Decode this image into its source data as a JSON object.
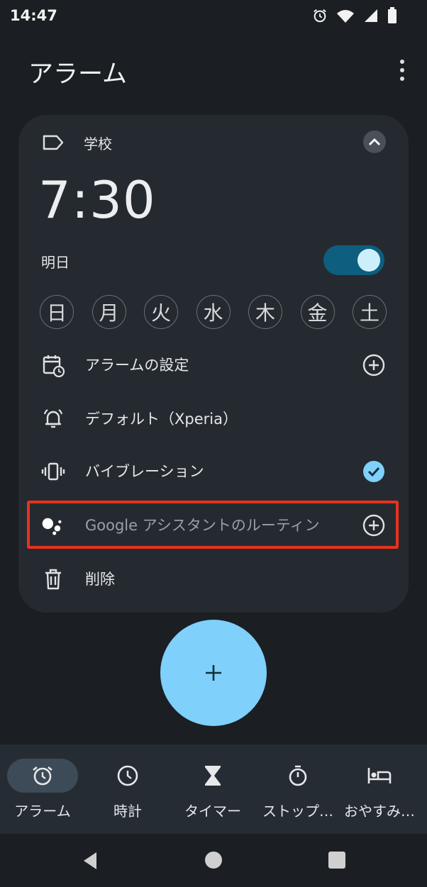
{
  "status_bar": {
    "time": "14:47",
    "icons": [
      "alarm-icon",
      "wifi-icon",
      "signal-icon",
      "battery-icon"
    ]
  },
  "app": {
    "title": "アラーム",
    "menu_icon": "more-vert-icon"
  },
  "alarm": {
    "label": "学校",
    "time": "7:30",
    "date": "明日",
    "enabled": true,
    "days": [
      "日",
      "月",
      "火",
      "水",
      "木",
      "金",
      "土"
    ],
    "options": [
      {
        "label": "アラームの設定",
        "icon": "calendar-clock-icon",
        "action": "add-circle-icon"
      },
      {
        "label": "デフォルト（Xperia）",
        "icon": "bell-ringing-icon",
        "action": ""
      },
      {
        "label": "バイブレーション",
        "icon": "vibration-icon",
        "action": "check-circle-icon"
      },
      {
        "label": "Google アシスタントのルーティン",
        "icon": "google-assistant-icon",
        "action": "add-circle-icon"
      },
      {
        "label": "削除",
        "icon": "trash-icon",
        "action": ""
      }
    ]
  },
  "fab": {
    "icon": "plus-icon"
  },
  "bottom_nav": [
    {
      "label": "アラーム",
      "icon": "alarm-icon",
      "active": true
    },
    {
      "label": "時計",
      "icon": "clock-icon",
      "active": false
    },
    {
      "label": "タイマー",
      "icon": "hourglass-icon",
      "active": false
    },
    {
      "label": "ストップ…",
      "icon": "stopwatch-icon",
      "active": false
    },
    {
      "label": "おやすみ…",
      "icon": "bed-icon",
      "active": false
    }
  ],
  "colors": {
    "accent": "#7fd0fb",
    "toggle_track": "#0d5e7f",
    "highlight": "#e8321e",
    "card": "#252a30",
    "background": "#1b1f23"
  }
}
